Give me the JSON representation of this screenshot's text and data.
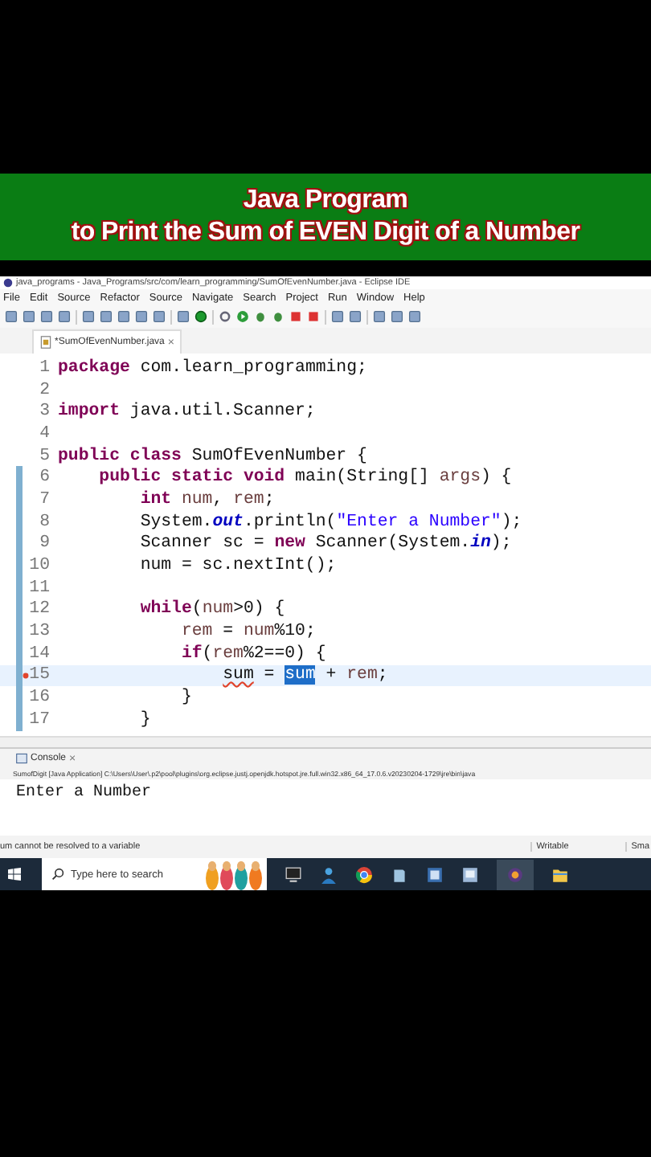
{
  "banner": {
    "lines": [
      "Java Program",
      "to Print the Sum of EVEN Digit of a Number"
    ]
  },
  "window": {
    "title": "java_programs - Java_Programs/src/com/learn_programming/SumOfEvenNumber.java - Eclipse IDE"
  },
  "menu": [
    "File",
    "Edit",
    "Source",
    "Refactor",
    "Source",
    "Navigate",
    "Search",
    "Project",
    "Run",
    "Window",
    "Help"
  ],
  "editor_tab": {
    "label": "*SumOfEvenNumber.java",
    "close": "×",
    "selected": true
  },
  "code": [
    {
      "n": "1",
      "tokens": [
        {
          "t": "package",
          "kind": "kw"
        },
        {
          "t": " com.learn_programming;",
          "kind": "plain"
        }
      ]
    },
    {
      "n": "2"
    },
    {
      "n": "3",
      "tokens": [
        {
          "t": "import",
          "kind": "kw"
        },
        {
          "t": " java.util.Scanner;",
          "kind": "plain"
        }
      ]
    },
    {
      "n": "4"
    },
    {
      "n": "5",
      "tokens": [
        {
          "t": "public class",
          "kind": "kw"
        },
        {
          "t": " SumOfEvenNumber {",
          "kind": "plain"
        }
      ]
    },
    {
      "n": "6",
      "changed": true,
      "tokens": [
        {
          "t": "    public static void",
          "kind": "kw"
        },
        {
          "t": " main(String[] ",
          "kind": "plain"
        },
        {
          "t": "args",
          "kind": "var"
        },
        {
          "t": ") {",
          "kind": "plain"
        }
      ]
    },
    {
      "n": "7",
      "changed": true,
      "tokens": [
        {
          "t": "        int",
          "kind": "kw"
        },
        {
          "t": " num",
          "kind": "var"
        },
        {
          "t": ", ",
          "kind": "plain"
        },
        {
          "t": "rem",
          "kind": "var"
        },
        {
          "t": ";",
          "kind": "plain"
        }
      ]
    },
    {
      "n": "8",
      "changed": true,
      "tokens": [
        {
          "t": "        System.",
          "kind": "plain"
        },
        {
          "t": "out",
          "kind": "field"
        },
        {
          "t": ".println(",
          "kind": "plain"
        },
        {
          "t": "\"Enter a Number\"",
          "kind": "str"
        },
        {
          "t": ");",
          "kind": "plain"
        }
      ]
    },
    {
      "n": "9",
      "changed": true,
      "tokens": [
        {
          "t": "        Scanner sc = ",
          "kind": "plain"
        },
        {
          "t": "new",
          "kind": "kw"
        },
        {
          "t": " Scanner(System.",
          "kind": "plain"
        },
        {
          "t": "in",
          "kind": "field"
        },
        {
          "t": ");",
          "kind": "plain"
        }
      ]
    },
    {
      "n": "10",
      "changed": true,
      "tokens": [
        {
          "t": "        num = sc.nextInt();",
          "kind": "plain"
        }
      ]
    },
    {
      "n": "11",
      "changed": true
    },
    {
      "n": "12",
      "changed": true,
      "tokens": [
        {
          "t": "        while",
          "kind": "kw"
        },
        {
          "t": "(",
          "kind": "plain"
        },
        {
          "t": "num",
          "kind": "var"
        },
        {
          "t": ">0) {",
          "kind": "plain"
        }
      ]
    },
    {
      "n": "13",
      "changed": true,
      "tokens": [
        {
          "t": "            rem",
          "kind": "var"
        },
        {
          "t": " = ",
          "kind": "plain"
        },
        {
          "t": "num",
          "kind": "var"
        },
        {
          "t": "%10;",
          "kind": "plain"
        }
      ]
    },
    {
      "n": "14",
      "changed": true,
      "tokens": [
        {
          "t": "            if",
          "kind": "kw"
        },
        {
          "t": "(",
          "kind": "plain"
        },
        {
          "t": "rem",
          "kind": "var"
        },
        {
          "t": "%2==0) {",
          "kind": "plain"
        }
      ]
    },
    {
      "n": "15",
      "changed": true,
      "current": true,
      "error": true,
      "tokens": [
        {
          "t": "                sum",
          "kind": "err"
        },
        {
          "t": " = ",
          "kind": "plain"
        },
        {
          "t": "sum",
          "kind": "sel"
        },
        {
          "t": " + ",
          "kind": "plain"
        },
        {
          "t": "rem",
          "kind": "var"
        },
        {
          "t": ";",
          "kind": "plain"
        }
      ]
    },
    {
      "n": "16",
      "changed": true,
      "tokens": [
        {
          "t": "            }",
          "kind": "plain"
        }
      ]
    },
    {
      "n": "17",
      "changed": true,
      "tokens": [
        {
          "t": "        }",
          "kind": "plain"
        }
      ]
    }
  ],
  "console": {
    "tab": "Console",
    "close": "×",
    "launch": "SumofDigit [Java Application] C:\\Users\\User\\.p2\\pool\\plugins\\org.eclipse.justj.openjdk.hotspot.jre.full.win32.x86_64_17.0.6.v20230204-1729\\jre\\bin\\java",
    "output": "Enter a Number"
  },
  "status_bar": {
    "message": "um cannot be resolved to a variable",
    "mode": "Writable",
    "insert": "Sma"
  },
  "taskbar": {
    "search": {
      "placeholder": "Type here to search"
    }
  }
}
